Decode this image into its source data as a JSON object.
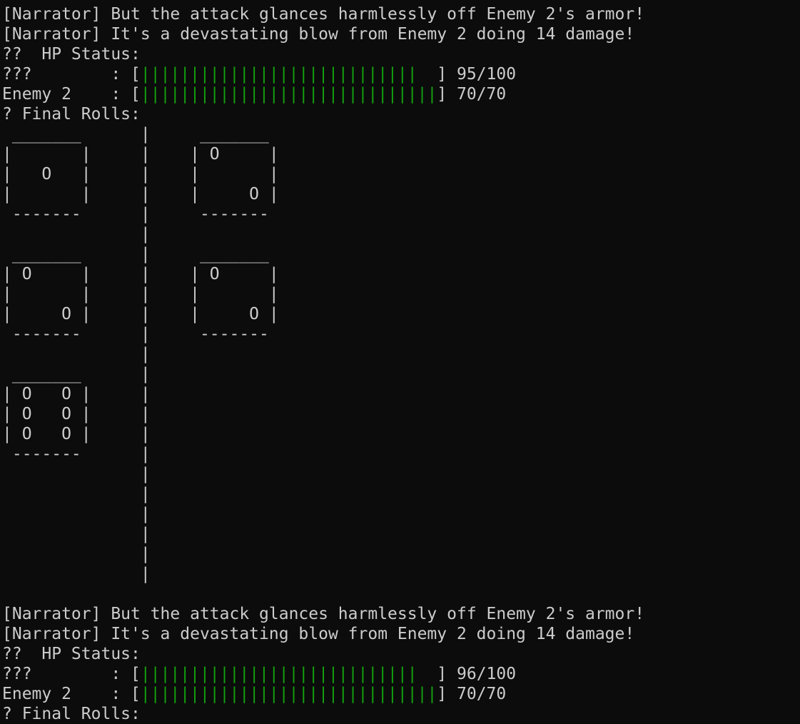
{
  "colors": {
    "background": "#0c0c0c",
    "text": "#cccccc",
    "hp_bar": "#13a10e"
  },
  "blocks": [
    {
      "narration": [
        "[Narrator] But the attack glances harmlessly off Enemy 2's armor!",
        "[Narrator] It's a devastating blow from Enemy 2 doing 14 damage!"
      ],
      "hp_title": "??  HP Status:",
      "hp": [
        {
          "label": "???        : ",
          "filled": 28,
          "segments": 30,
          "value": "95/100"
        },
        {
          "label": "Enemy 2    : ",
          "filled": 30,
          "segments": 30,
          "value": "70/70"
        }
      ],
      "rolls_title": "? Final Rolls:",
      "dice_art": [
        " _______      |     _______",
        "|       |     |    | O     |",
        "|   O   |     |    |       |",
        "|       |     |    |     O |",
        " -------      |     -------",
        "              |",
        " _______      |     _______",
        "| O     |     |    | O     |",
        "|       |     |    |       |",
        "|     O |     |    |     O |",
        " -------      |     -------",
        "              |",
        " _______      |",
        "| O   O |     |",
        "| O   O |     |",
        "| O   O |     |",
        " -------      |",
        "              |",
        "              |",
        "              |",
        "              |",
        "              |",
        "              |",
        ""
      ]
    },
    {
      "narration": [
        "[Narrator] But the attack glances harmlessly off Enemy 2's armor!",
        "[Narrator] It's a devastating blow from Enemy 2 doing 14 damage!"
      ],
      "hp_title": "??  HP Status:",
      "hp": [
        {
          "label": "???        : ",
          "filled": 28,
          "segments": 30,
          "value": "96/100"
        },
        {
          "label": "Enemy 2    : ",
          "filled": 30,
          "segments": 30,
          "value": "70/70"
        }
      ],
      "rolls_title": "? Final Rolls:",
      "dice_art": []
    }
  ]
}
